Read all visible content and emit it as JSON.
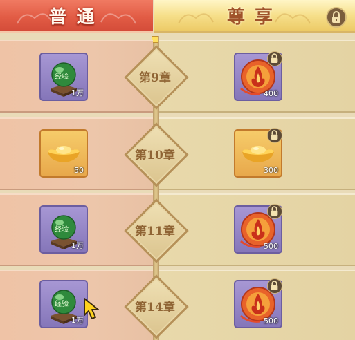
{
  "tabs": {
    "normal": "普通",
    "vip": "尊享",
    "vip_locked": true
  },
  "rows": [
    {
      "chapter": "第9章",
      "normal": {
        "icon": "experience-orb-icon",
        "orb_text": "经验",
        "qty": "1万",
        "frame": "purple"
      },
      "vip": {
        "icon": "fire-orb-icon",
        "qty": "400",
        "frame": "purple",
        "locked": true
      }
    },
    {
      "chapter": "第10章",
      "normal": {
        "icon": "gold-ingot-icon",
        "qty": "50",
        "frame": "gold"
      },
      "vip": {
        "icon": "gold-ingot-icon",
        "qty": "300",
        "frame": "gold",
        "locked": true
      }
    },
    {
      "chapter": "第11章",
      "normal": {
        "icon": "experience-orb-icon",
        "orb_text": "经验",
        "qty": "1万",
        "frame": "purple"
      },
      "vip": {
        "icon": "fire-orb-icon",
        "qty": "500",
        "frame": "purple",
        "locked": true
      }
    },
    {
      "chapter": "第14章",
      "normal": {
        "icon": "experience-orb-icon",
        "orb_text": "经验",
        "qty": "1万",
        "frame": "purple"
      },
      "vip": {
        "icon": "fire-orb-icon",
        "qty": "500",
        "frame": "purple",
        "locked": true
      }
    }
  ],
  "colors": {
    "normal_tab": "#e25c45",
    "vip_tab": "#f6df8a",
    "normal_row": "#edc6aa",
    "vip_row": "#e4d3a3",
    "chapter_text": "#8f6434"
  }
}
